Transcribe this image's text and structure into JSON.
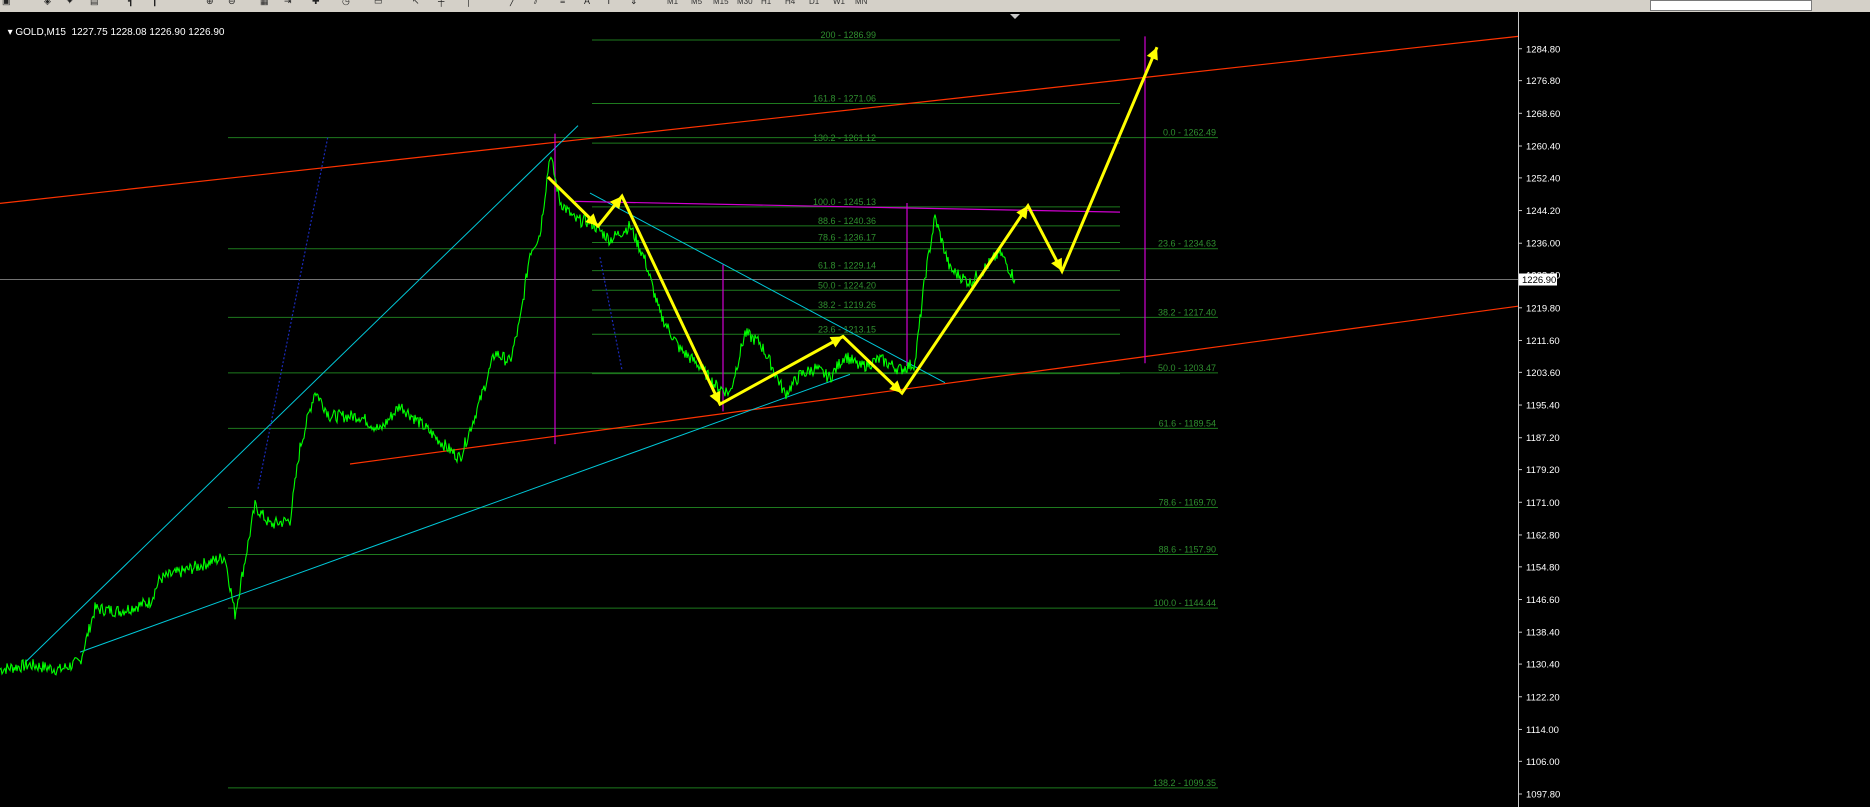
{
  "window": {
    "symbol": "GOLD,M15",
    "ohlc": "1227.75 1228.08 1226.90 1226.90",
    "current_price_label": "1226.90"
  },
  "toolbar": {
    "timeframes": [
      "M1",
      "M5",
      "M15",
      "M30",
      "H1",
      "H4",
      "D1",
      "W1",
      "MN"
    ],
    "icons": [
      "new-chart-icon",
      "profiles-icon",
      "zoom-in-icon",
      "zoom-out-icon",
      "tile-icon",
      "add-indicator-icon",
      "cursor-icon",
      "crosshair-icon",
      "trendline-icon",
      "text-icon",
      "label-icon"
    ]
  },
  "colors": {
    "background": "#000000",
    "price_line": "#00ff00",
    "fib": "#1e7a1e",
    "fib_text": "#2f8f2f",
    "channel": "#ff3300",
    "trendline": "#00c8d8",
    "yellow_path": "#ffff00",
    "magenta": "#d000d0",
    "axis_text": "#ffffff",
    "dotted": "#1a2ab8"
  },
  "chart_data": {
    "type": "line",
    "symbol": "GOLD",
    "timeframe": "M15",
    "ylim": [
      1097.8,
      1288.0
    ],
    "x_range": [
      0,
      1518
    ],
    "y_ticks": [
      "1284.80",
      "1276.80",
      "1268.60",
      "1260.40",
      "1252.40",
      "1244.20",
      "1236.00",
      "1228.00",
      "1219.80",
      "1211.60",
      "1203.60",
      "1195.40",
      "1187.20",
      "1179.20",
      "1171.00",
      "1162.80",
      "1154.80",
      "1146.60",
      "1138.40",
      "1130.40",
      "1122.20",
      "1114.00",
      "1106.00",
      "1097.80"
    ],
    "current_price": 1226.9,
    "price_anchors": [
      [
        0,
        1129.1
      ],
      [
        30,
        1130.2
      ],
      [
        60,
        1129.0
      ],
      [
        80,
        1131.0
      ],
      [
        95,
        1144.3
      ],
      [
        120,
        1143.7
      ],
      [
        150,
        1146.0
      ],
      [
        160,
        1151.8
      ],
      [
        190,
        1154.3
      ],
      [
        225,
        1157.3
      ],
      [
        235,
        1142.9
      ],
      [
        255,
        1170.1
      ],
      [
        270,
        1165.4
      ],
      [
        290,
        1166.5
      ],
      [
        300,
        1184.7
      ],
      [
        315,
        1199.0
      ],
      [
        330,
        1192.6
      ],
      [
        360,
        1192.6
      ],
      [
        380,
        1189.1
      ],
      [
        400,
        1195.3
      ],
      [
        420,
        1190.9
      ],
      [
        450,
        1184.1
      ],
      [
        460,
        1182.1
      ],
      [
        480,
        1196.4
      ],
      [
        495,
        1208.5
      ],
      [
        510,
        1206.2
      ],
      [
        520,
        1216.4
      ],
      [
        530,
        1233.8
      ],
      [
        540,
        1238.3
      ],
      [
        550,
        1258.4
      ],
      [
        560,
        1246.5
      ],
      [
        575,
        1241.8
      ],
      [
        590,
        1241.4
      ],
      [
        610,
        1236.9
      ],
      [
        630,
        1240.3
      ],
      [
        645,
        1231.8
      ],
      [
        660,
        1218.2
      ],
      [
        680,
        1209.4
      ],
      [
        700,
        1205.1
      ],
      [
        715,
        1200.4
      ],
      [
        730,
        1198.4
      ],
      [
        745,
        1213.4
      ],
      [
        760,
        1211.0
      ],
      [
        770,
        1206.2
      ],
      [
        785,
        1198.1
      ],
      [
        800,
        1202.9
      ],
      [
        815,
        1204.6
      ],
      [
        830,
        1202.2
      ],
      [
        845,
        1207.9
      ],
      [
        860,
        1204.9
      ],
      [
        880,
        1206.9
      ],
      [
        900,
        1204.3
      ],
      [
        915,
        1205.9
      ],
      [
        925,
        1227.4
      ],
      [
        935,
        1242.5
      ],
      [
        950,
        1229.5
      ],
      [
        970,
        1226.1
      ],
      [
        985,
        1229.8
      ],
      [
        1000,
        1233.8
      ],
      [
        1015,
        1226.9
      ]
    ],
    "fibonacci_upper": [
      {
        "level": "200",
        "price": 1286.99,
        "label": "200 - 1286.99"
      },
      {
        "level": "161.8",
        "price": 1271.06,
        "label": "161.8 - 1271.06"
      },
      {
        "level": "130.2",
        "price": 1261.12,
        "label": "130.2 - 1261.12"
      },
      {
        "level": "100.0",
        "price": 1245.13,
        "label": "100.0 - 1245.13"
      },
      {
        "level": "88.6",
        "price": 1240.36,
        "label": "88.6 - 1240.36"
      },
      {
        "level": "78.6",
        "price": 1236.17,
        "label": "78.6 - 1236.17"
      },
      {
        "level": "61.8",
        "price": 1229.14,
        "label": "61.8 - 1229.14"
      },
      {
        "level": "50.0",
        "price": 1224.2,
        "label": "50.0 - 1224.20"
      },
      {
        "level": "38.2",
        "price": 1219.26,
        "label": "38.2 - 1219.26"
      },
      {
        "level": "23.6",
        "price": 1213.15,
        "label": "23.6 - 1213.15"
      },
      {
        "level": "0.0",
        "price": 1203.27,
        "label": ""
      }
    ],
    "fibonacci_lower": [
      {
        "level": "0.0",
        "price": 1262.49,
        "label": "0.0 - 1262.49"
      },
      {
        "level": "23.6",
        "price": 1234.63,
        "label": "23.6 - 1234.63"
      },
      {
        "level": "38.2",
        "price": 1217.4,
        "label": "38.2 - 1217.40"
      },
      {
        "level": "50.0",
        "price": 1203.47,
        "label": "50.0 - 1203.47"
      },
      {
        "level": "61.6",
        "price": 1189.54,
        "label": "61.6 - 1189.54"
      },
      {
        "level": "78.6",
        "price": 1169.7,
        "label": "78.6 - 1169.70"
      },
      {
        "level": "88.6",
        "price": 1157.9,
        "label": "88.6 - 1157.90"
      },
      {
        "level": "100.0",
        "price": 1144.44,
        "label": "100.0 - 1144.44"
      },
      {
        "level": "138.2",
        "price": 1099.35,
        "label": "138.2 - 1099.35"
      }
    ],
    "channel_lines": [
      {
        "from": [
          0,
          1246.0
        ],
        "to": [
          1518,
          1287.9
        ]
      },
      {
        "from": [
          350,
          1180.6
        ],
        "to": [
          1518,
          1220.2
        ]
      }
    ],
    "trend_lines": [
      {
        "from": [
          25,
          1130.8
        ],
        "to": [
          578,
          1265.5
        ]
      },
      {
        "from": [
          80,
          1133.4
        ],
        "to": [
          850,
          1203.1
        ]
      },
      {
        "from": [
          590,
          1248.6
        ],
        "to": [
          945,
          1201.0
        ]
      }
    ],
    "dotted_lines": [
      {
        "from": [
          258,
          1174.4
        ],
        "to": [
          328,
          1262.9
        ]
      },
      {
        "from": [
          600,
          1232.5
        ],
        "to": [
          622,
          1204.2
        ]
      }
    ],
    "magenta_lines": [
      {
        "from": [
          555,
          1263.5
        ],
        "to": [
          555,
          1185.6
        ]
      },
      {
        "from": [
          723,
          1230.6
        ],
        "to": [
          723,
          1193.8
        ]
      },
      {
        "from": [
          907,
          1246.1
        ],
        "to": [
          907,
          1205.2
        ]
      },
      {
        "from": [
          1145,
          1287.9
        ],
        "to": [
          1145,
          1205.9
        ]
      },
      {
        "from": [
          575,
          1246.5
        ],
        "to": [
          1120,
          1243.8
        ]
      }
    ],
    "projected_path": [
      [
        548,
        1252.6
      ],
      [
        598,
        1240.3
      ],
      [
        622,
        1247.8
      ],
      [
        720,
        1195.6
      ],
      [
        843,
        1212.6
      ],
      [
        902,
        1198.4
      ],
      [
        1028,
        1245.4
      ],
      [
        1062,
        1229.0
      ],
      [
        1157,
        1285.2
      ]
    ]
  }
}
